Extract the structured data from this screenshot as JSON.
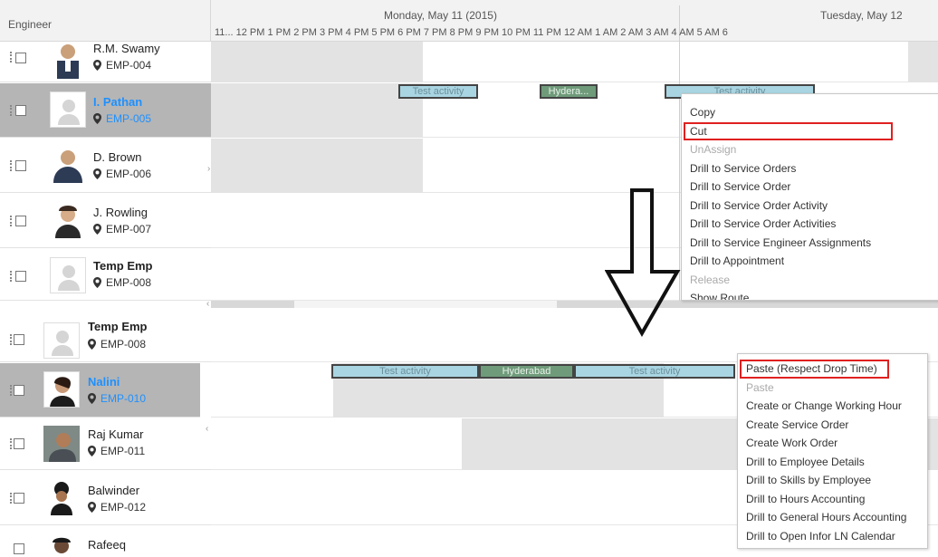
{
  "header": {
    "engineer_label": "Engineer",
    "day1": "Monday, May 11 (2015)",
    "day2": "Tuesday, May 12",
    "hours": "11... 12 PM  1 PM  2 PM  3 PM  4 PM  5 PM  6 PM  7 PM  8 PM  9 PM 10 PM 11 PM 12 AM  1 AM  2 AM  3 AM  4 AM  5 AM  6"
  },
  "top_rows": [
    {
      "name": "R.M. Swamy",
      "emp": "EMP-004"
    },
    {
      "name": "I. Pathan",
      "emp": "EMP-005",
      "selected": true
    },
    {
      "name": "D. Brown",
      "emp": "EMP-006"
    },
    {
      "name": "J. Rowling",
      "emp": "EMP-007"
    },
    {
      "name": "Temp Emp",
      "emp": "EMP-008"
    }
  ],
  "bottom_rows": [
    {
      "name": "Temp Emp",
      "emp": "EMP-008"
    },
    {
      "name": "Nalini",
      "emp": "EMP-010",
      "selected": true
    },
    {
      "name": "Raj Kumar",
      "emp": "EMP-011"
    },
    {
      "name": "Balwinder",
      "emp": "EMP-012"
    },
    {
      "name": "Rafeeq",
      "emp": ""
    }
  ],
  "top_bars": [
    "Test activity",
    "Hydera...",
    "Test activity"
  ],
  "bottom_bars": [
    "Test activity",
    "Hyderabad",
    "Test activity"
  ],
  "menu1": [
    {
      "label": "Copy"
    },
    {
      "label": "Cut",
      "highlight": true
    },
    {
      "label": "UnAssign",
      "disabled": true
    },
    {
      "label": "Drill to Service Orders"
    },
    {
      "label": "Drill to Service Order"
    },
    {
      "label": "Drill to Service Order Activity"
    },
    {
      "label": "Drill to Service Order Activities"
    },
    {
      "label": "Drill to Service Engineer Assignments"
    },
    {
      "label": "Drill to Appointment"
    },
    {
      "label": "Release",
      "disabled": true
    },
    {
      "label": "Show Route"
    }
  ],
  "menu2": [
    {
      "label": "Paste (Respect Drop Time)",
      "highlight": true
    },
    {
      "label": "Paste",
      "disabled": true
    },
    {
      "label": "Create or Change Working Hour"
    },
    {
      "label": "Create Service Order"
    },
    {
      "label": "Create Work Order"
    },
    {
      "label": "Drill to Employee Details"
    },
    {
      "label": "Drill to Skills by Employee"
    },
    {
      "label": "Drill to Hours Accounting"
    },
    {
      "label": "Drill to General Hours Accounting"
    },
    {
      "label": "Drill to Open Infor LN Calendar"
    }
  ],
  "colors": {
    "accent": "#1e90ff",
    "highlight_border": "#e02020",
    "bar": "#a9d5e2",
    "bar_green": "#6f9b7a",
    "selected_row": "#b5b5b5"
  },
  "icons": [
    "map-pin-icon",
    "down-arrow-icon",
    "person-placeholder-icon"
  ]
}
